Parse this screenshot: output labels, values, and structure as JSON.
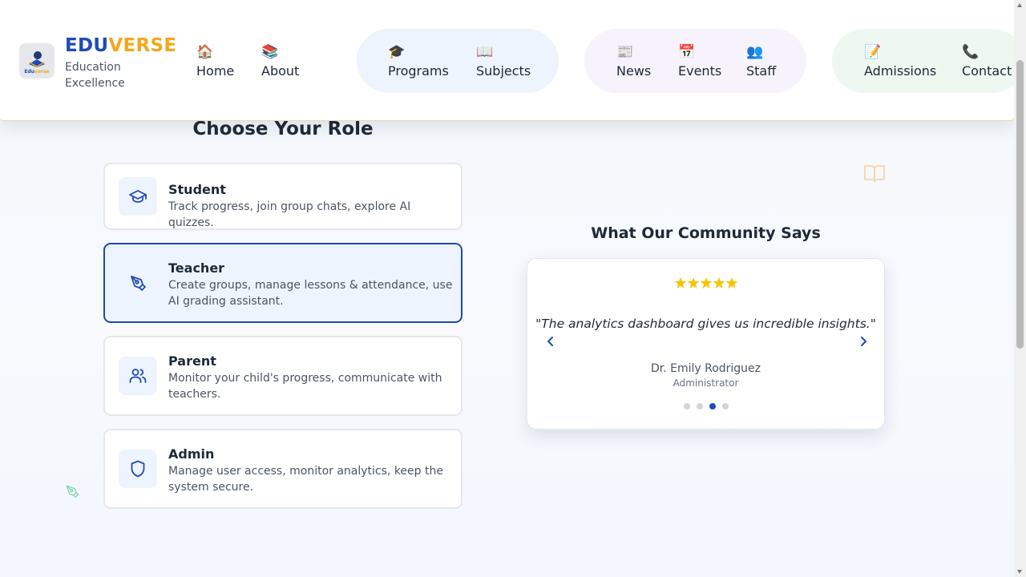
{
  "brand": {
    "part1": "EDU",
    "part2": "VERSE",
    "tagline": "Education Excellence",
    "logo_text": "Eduverse"
  },
  "nav": {
    "items": [
      {
        "label": "Home",
        "icon": "🏠",
        "icon_name": "house-icon"
      },
      {
        "label": "About",
        "icon": "📚",
        "icon_name": "books-icon"
      },
      {
        "label": "Programs",
        "icon": "🎓",
        "icon_name": "graduation-cap-icon"
      },
      {
        "label": "Subjects",
        "icon": "📖",
        "icon_name": "open-book-icon"
      },
      {
        "label": "News",
        "icon": "📰",
        "icon_name": "newspaper-icon"
      },
      {
        "label": "Events",
        "icon": "📅",
        "icon_name": "calendar-icon"
      },
      {
        "label": "Staff",
        "icon": "👥",
        "icon_name": "people-icon"
      },
      {
        "label": "Admissions",
        "icon": "📝",
        "icon_name": "memo-icon"
      },
      {
        "label": "Contact",
        "icon": "📞",
        "icon_name": "phone-icon"
      }
    ]
  },
  "roles": {
    "title": "Choose Your Role",
    "items": [
      {
        "name": "Student",
        "description": "Track progress, join group chats, explore AI quizzes.",
        "icon": "graduation-cap-icon",
        "selected": false
      },
      {
        "name": "Teacher",
        "description": "Create groups, manage lessons & attendance, use AI grading assistant.",
        "icon": "pen-tool-icon",
        "selected": true
      },
      {
        "name": "Parent",
        "description": "Monitor your child's progress, communicate with teachers.",
        "icon": "users-icon",
        "selected": false
      },
      {
        "name": "Admin",
        "description": "Manage user access, monitor analytics, keep the system secure.",
        "icon": "shield-icon",
        "selected": false
      }
    ]
  },
  "testimonials": {
    "title": "What Our Community Says",
    "rating": 5,
    "quote": "\"The analytics dashboard gives us incredible insights.\"",
    "author": "Dr. Emily Rodriguez",
    "author_role": "Administrator",
    "total_slides": 4,
    "active_slide": 3
  },
  "colors": {
    "brand_blue": "#1e4bb8",
    "brand_gold": "#f2a81d",
    "star": "#f6c400",
    "selected_border": "#1e4ba6"
  }
}
